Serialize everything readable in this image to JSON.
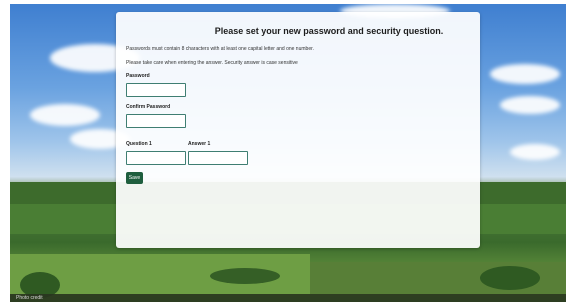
{
  "form": {
    "title": "Please set your new password and security question.",
    "password_rule": "Passwords must contain 8 characters with at least one capital letter and one number.",
    "security_note": "Please take care when entering the answer. Security answer is case sensitive",
    "password_label": "Password",
    "password_value": "",
    "confirm_label": "Confirm Password",
    "confirm_value": "",
    "question_label": "Question 1",
    "question_value": "",
    "answer_label": "Answer 1",
    "answer_value": "",
    "save_label": "Save"
  },
  "footer": {
    "credit": "Photo credit"
  },
  "colors": {
    "input_border": "#3f7e72",
    "button_bg": "#1f5e3e",
    "card_bg": "#ffffff"
  }
}
